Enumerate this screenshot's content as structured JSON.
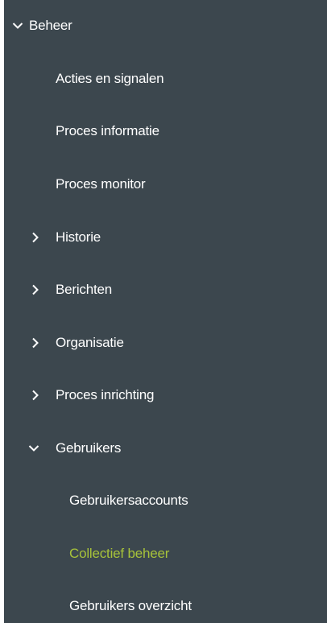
{
  "theme": {
    "panel_bg": "#3c474e",
    "text": "#ffffff",
    "active_text": "#a7c23a"
  },
  "nav": {
    "root": {
      "label": "Beheer",
      "icon": "chevron-down-icon",
      "expanded": true
    },
    "items": [
      {
        "label": "Acties en signalen",
        "level": 1,
        "type": "leaf"
      },
      {
        "label": "Proces informatie",
        "level": 1,
        "type": "leaf"
      },
      {
        "label": "Proces monitor",
        "level": 1,
        "type": "leaf"
      },
      {
        "label": "Historie",
        "level": 1,
        "type": "group",
        "icon": "chevron-right-icon",
        "expanded": false
      },
      {
        "label": "Berichten",
        "level": 1,
        "type": "group",
        "icon": "chevron-right-icon",
        "expanded": false
      },
      {
        "label": "Organisatie",
        "level": 1,
        "type": "group",
        "icon": "chevron-right-icon",
        "expanded": false
      },
      {
        "label": "Proces inrichting",
        "level": 1,
        "type": "group",
        "icon": "chevron-right-icon",
        "expanded": false
      },
      {
        "label": "Gebruikers",
        "level": 1,
        "type": "group",
        "icon": "chevron-down-icon",
        "expanded": true
      },
      {
        "label": "Gebruikersaccounts",
        "level": 2,
        "type": "leaf"
      },
      {
        "label": "Collectief beheer",
        "level": 2,
        "type": "leaf",
        "active": true
      },
      {
        "label": "Gebruikers overzicht",
        "level": 2,
        "type": "leaf"
      }
    ]
  }
}
